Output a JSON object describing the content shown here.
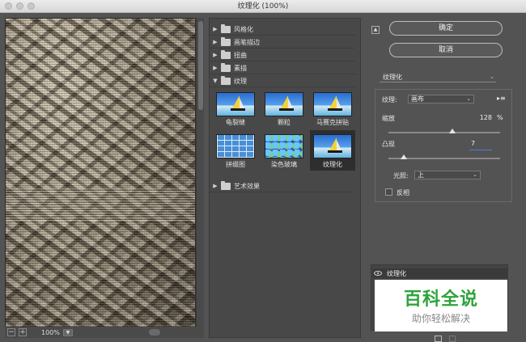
{
  "window": {
    "title": "纹理化 (100%)"
  },
  "preview": {
    "zoom": "100%",
    "zoom_out": "−",
    "zoom_in": "+"
  },
  "filter_gallery": {
    "categories": [
      {
        "label": "风格化",
        "expanded": false
      },
      {
        "label": "画笔描边",
        "expanded": false
      },
      {
        "label": "扭曲",
        "expanded": false
      },
      {
        "label": "素描",
        "expanded": false
      },
      {
        "label": "纹理",
        "expanded": true
      },
      {
        "label": "艺术效果",
        "expanded": false
      }
    ],
    "texture_filters": [
      {
        "label": "龟裂缝",
        "selected": false
      },
      {
        "label": "颗粒",
        "selected": false
      },
      {
        "label": "马赛克拼贴",
        "selected": false
      },
      {
        "label": "拼缀图",
        "selected": false
      },
      {
        "label": "染色玻璃",
        "selected": false
      },
      {
        "label": "纹理化",
        "selected": true
      }
    ]
  },
  "buttons": {
    "ok": "确定",
    "cancel": "取消"
  },
  "settings": {
    "filter_select": "纹理化",
    "texture_label": "纹理:",
    "texture_value": "画布",
    "scaling_label": "缩放",
    "scaling_value": "128",
    "scaling_unit": "%",
    "scaling_fraction": 0.57,
    "relief_label": "凸现",
    "relief_value": "7",
    "relief_fraction": 0.14,
    "light_label": "光照:",
    "light_value": "上",
    "invert_label": "反相",
    "invert_checked": false
  },
  "layers": {
    "active_layer": "纹理化"
  },
  "watermark": {
    "line1": "百科全说",
    "line2": "助你轻松解决"
  },
  "colors": {
    "accent": "#4f7ed6",
    "watermark_green": "#2ea33a"
  }
}
